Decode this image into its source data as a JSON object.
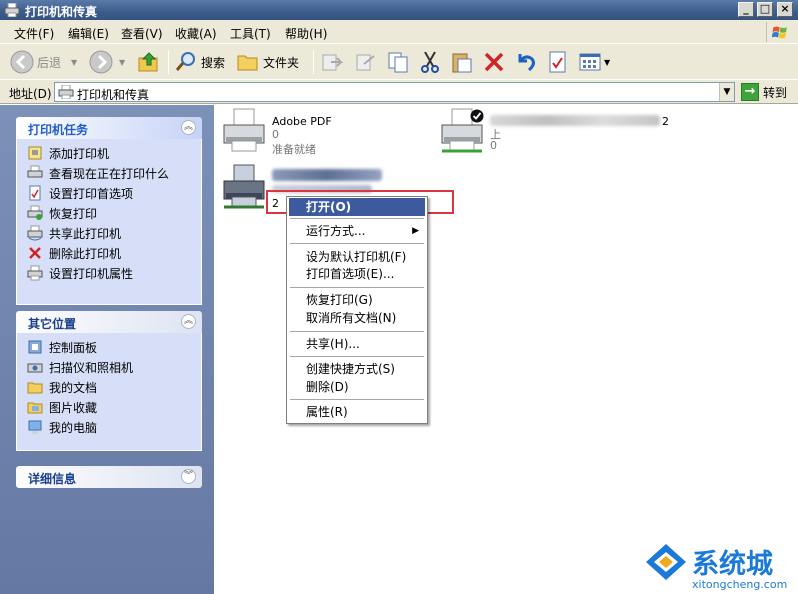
{
  "window": {
    "title": "打印机和传真"
  },
  "menubar": {
    "items": [
      "文件(F)",
      "编辑(E)",
      "查看(V)",
      "收藏(A)",
      "工具(T)",
      "帮助(H)"
    ]
  },
  "toolbar": {
    "back_label": "后退",
    "search_label": "搜索",
    "folders_label": "文件夹"
  },
  "address": {
    "label": "地址(D)",
    "value": "打印机和传真",
    "go_label": "转到"
  },
  "task_pane": {
    "printer_tasks": {
      "title": "打印机任务",
      "items": [
        {
          "label": "添加打印机",
          "icon": "add-printer-icon"
        },
        {
          "label": "查看现在正在打印什么",
          "icon": "print-queue-icon"
        },
        {
          "label": "设置打印首选项",
          "icon": "print-preferences-icon"
        },
        {
          "label": "恢复打印",
          "icon": "resume-printing-icon"
        },
        {
          "label": "共享此打印机",
          "icon": "share-printer-icon"
        },
        {
          "label": "删除此打印机",
          "icon": "delete-icon"
        },
        {
          "label": "设置打印机属性",
          "icon": "printer-properties-icon"
        }
      ]
    },
    "other_places": {
      "title": "其它位置",
      "items": [
        {
          "label": "控制面板",
          "icon": "control-panel-icon"
        },
        {
          "label": "扫描仪和照相机",
          "icon": "scanner-camera-icon"
        },
        {
          "label": "我的文档",
          "icon": "my-documents-icon"
        },
        {
          "label": "图片收藏",
          "icon": "my-pictures-icon"
        },
        {
          "label": "我的电脑",
          "icon": "my-computer-icon"
        }
      ]
    },
    "details": {
      "title": "详细信息"
    }
  },
  "printers": [
    {
      "name": "Adobe PDF",
      "count": "0",
      "status": "准备就绪"
    },
    {
      "name": "2",
      "count": "0",
      "status": "上"
    },
    {
      "name": "",
      "count": "2",
      "status": ""
    }
  ],
  "context_menu": {
    "items": [
      {
        "label": "打开(O)",
        "selected": true
      },
      {
        "label": "运行方式...",
        "submenu": true
      },
      {
        "label": "设为默认打印机(F)"
      },
      {
        "label": "打印首选项(E)..."
      },
      {
        "label": "恢复打印(G)"
      },
      {
        "label": "取消所有文档(N)"
      },
      {
        "label": "共享(H)..."
      },
      {
        "label": "创建快捷方式(S)"
      },
      {
        "label": "删除(D)"
      },
      {
        "label": "属性(R)"
      }
    ]
  },
  "watermark": {
    "brand": "系统城",
    "url": "xitongcheng.com"
  },
  "colors": {
    "titlebar": "#3c5c8c",
    "taskpane": "#7c91b8",
    "menu_selected": "#3d5a9e",
    "highlight": "#d9363e",
    "watermark": "#1b7ad8"
  }
}
